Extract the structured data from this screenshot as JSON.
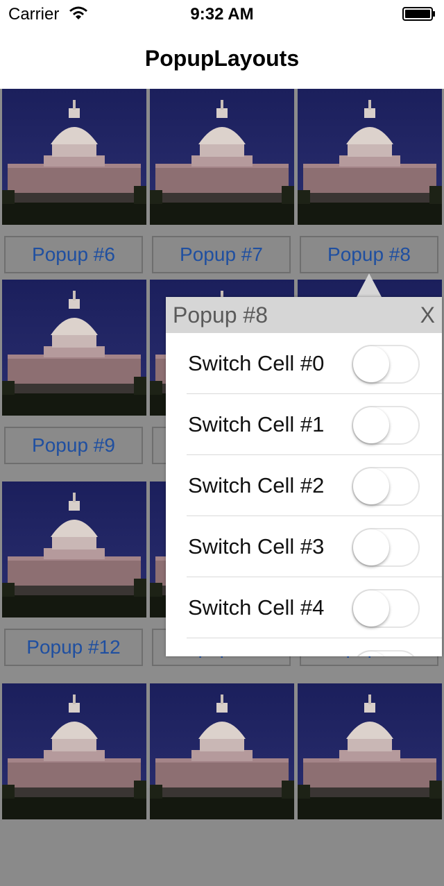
{
  "status_bar": {
    "carrier": "Carrier",
    "time": "9:32 AM"
  },
  "nav": {
    "title": "PopupLayouts"
  },
  "grid": {
    "rows": [
      [
        "Popup #6",
        "Popup #7",
        "Popup #8"
      ],
      [
        "Popup #9",
        "",
        ""
      ],
      [
        "Popup #12",
        "Popup #13",
        "Popup #14"
      ],
      [
        "",
        "",
        ""
      ]
    ]
  },
  "popover": {
    "title": "Popup #8",
    "close_label": "X",
    "items": [
      {
        "label": "Switch Cell #0",
        "on": false
      },
      {
        "label": "Switch Cell #1",
        "on": false
      },
      {
        "label": "Switch Cell #2",
        "on": false
      },
      {
        "label": "Switch Cell #3",
        "on": false
      },
      {
        "label": "Switch Cell #4",
        "on": false
      },
      {
        "label": "",
        "on": false
      }
    ]
  },
  "colors": {
    "button_text": "#1f4fa0",
    "popover_header": "#d6d6d6",
    "sky": "#1c2260"
  }
}
